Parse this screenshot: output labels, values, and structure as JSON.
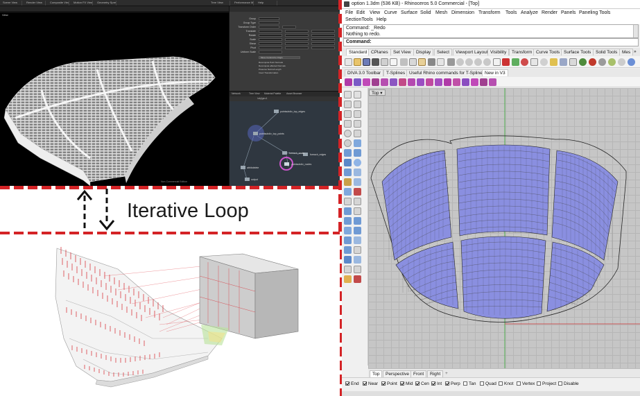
{
  "houdini": {
    "tabs": [
      "Scene View",
      "Render View",
      "Composite View",
      "Motion FX View",
      "Geometry Spreadsheet",
      "Tree View",
      "Performance Monitor",
      "Help"
    ],
    "view_label": "View",
    "status_text": "Non-Commercial Edition",
    "param_labels": [
      "Group",
      "Group Type",
      "Transform Order",
      "Translate",
      "Rotate",
      "Scale",
      "Shear",
      "Pivot",
      "Uniform Scale"
    ],
    "param_options": [
      "Move Centroid to Origin",
      "Recompute Point Normals",
      "Recompute affected Normals",
      "Preserve Normal Length",
      "Invert Transformation"
    ],
    "net_tabs": [
      "Network",
      "Tree View",
      "Material Palette",
      "Asset Browser"
    ],
    "net_path": "/obj/geo1",
    "nodes": [
      "pointsubdiv_top_edges",
      "pointsubdiv_top_points",
      "foreach_seats",
      "foreach_edges",
      "pointsubdiv_nodes",
      "attribdelete",
      "output"
    ]
  },
  "loop_label": "Iterative Loop",
  "rhino": {
    "title": "option 1.3dm (536 KB) - Rhinoceros 5.0 Commercial - [Top]",
    "menu_row1": [
      "File",
      "Edit",
      "View",
      "Curve",
      "Surface",
      "Solid",
      "Mesh",
      "Dimension",
      "Transform",
      "Tools",
      "Analyze",
      "Render",
      "Panels",
      "Paneling Tools"
    ],
    "menu_row2": [
      "SectionTools",
      "Help"
    ],
    "command_history": [
      "Command: _Redo",
      "Nothing to redo."
    ],
    "command_prompt": "Command:",
    "toolbar_tabs1": [
      "Standard",
      "CPlanes",
      "Set View",
      "Display",
      "Select",
      "Viewport Layout",
      "Visibility",
      "Transform",
      "Curve Tools",
      "Surface Tools",
      "Solid Tools",
      "Mes",
      "»"
    ],
    "toolbar_tabs2": [
      "DIVA 3.0 Toolbar",
      "T-Splines",
      "Useful Rhino commands for T-Splines",
      "New in V3"
    ],
    "viewport_label": "Top",
    "viewport_tabs": [
      "Top",
      "Perspective",
      "Front",
      "Right",
      "+"
    ],
    "osnaps": [
      {
        "label": "End",
        "checked": true
      },
      {
        "label": "Near",
        "checked": true
      },
      {
        "label": "Point",
        "checked": true
      },
      {
        "label": "Mid",
        "checked": true
      },
      {
        "label": "Cen",
        "checked": true
      },
      {
        "label": "Int",
        "checked": true
      },
      {
        "label": "Perp",
        "checked": true
      },
      {
        "label": "Tan",
        "checked": false
      },
      {
        "label": "Quad",
        "checked": false
      },
      {
        "label": "Knot",
        "checked": false
      },
      {
        "label": "Vertex",
        "checked": false
      },
      {
        "label": "Project",
        "checked": false
      },
      {
        "label": "Disable",
        "checked": false
      }
    ]
  },
  "colors": {
    "dashed_separator": "#d42326",
    "seat_fill": "#8a8fe0",
    "grid_bg": "#c6c6c6",
    "axis_x": "#cc3333",
    "axis_y": "#33aa33"
  }
}
